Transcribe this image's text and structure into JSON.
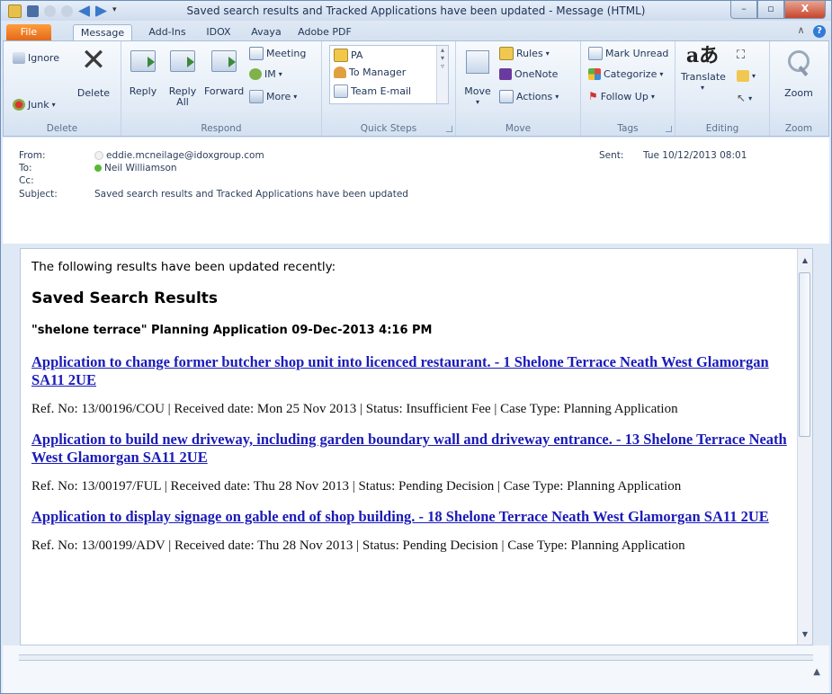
{
  "window": {
    "title": "Saved search results and Tracked Applications have been updated  -  Message (HTML)",
    "minimize": "–",
    "maximize": "▫",
    "close": "X"
  },
  "tabs": [
    "File",
    "Message",
    "Add-Ins",
    "IDOX",
    "Avaya",
    "Adobe PDF"
  ],
  "ribbon": {
    "delete_group": {
      "label": "Delete",
      "ignore": "Ignore",
      "junk": "Junk",
      "delete": "Delete"
    },
    "respond_group": {
      "label": "Respond",
      "reply": "Reply",
      "reply_all_1": "Reply",
      "reply_all_2": "All",
      "forward": "Forward",
      "meeting": "Meeting",
      "im": "IM",
      "more": "More"
    },
    "quick_steps": {
      "label": "Quick Steps",
      "items": [
        "PA",
        "To Manager",
        "Team E-mail"
      ]
    },
    "move_group": {
      "label": "Move",
      "move": "Move",
      "rules": "Rules",
      "onenote": "OneNote",
      "actions": "Actions"
    },
    "tags_group": {
      "label": "Tags",
      "mark_unread": "Mark Unread",
      "categorize": "Categorize",
      "follow_up": "Follow Up"
    },
    "editing_group": {
      "label": "Editing",
      "translate": "Translate"
    },
    "zoom_group": {
      "label": "Zoom",
      "zoom": "Zoom"
    }
  },
  "headers": {
    "from_label": "From:",
    "from": "eddie.mcneilage@idoxgroup.com",
    "to_label": "To:",
    "to": "Neil Williamson",
    "cc_label": "Cc:",
    "subject_label": "Subject:",
    "subject": "Saved search results and Tracked Applications have been updated",
    "sent_label": "Sent:",
    "sent": "Tue 10/12/2013 08:01"
  },
  "body": {
    "intro": "The following results have been updated recently:",
    "heading": "Saved Search Results",
    "search_title": "\"shelone terrace\" Planning Application 09-Dec-2013 4:16 PM",
    "results": [
      {
        "link": "Application to change former butcher shop unit into licenced restaurant. - 1 Shelone Terrace Neath West Glamorgan SA11 2UE",
        "ref": "Ref. No: 13/00196/COU | Received date: Mon 25 Nov 2013 | Status: Insufficient Fee | Case Type: Planning Application"
      },
      {
        "link": "Application to build new driveway, including garden boundary wall and driveway entrance. - 13 Shelone Terrace Neath West Glamorgan SA11 2UE",
        "ref": "Ref. No: 13/00197/FUL | Received date: Thu 28 Nov 2013 | Status: Pending Decision | Case Type: Planning Application"
      },
      {
        "link": "Application to display signage on gable end of shop building. - 18 Shelone Terrace Neath West Glamorgan SA11 2UE",
        "ref": "Ref. No: 13/00199/ADV | Received date: Thu 28 Nov 2013 | Status: Pending Decision | Case Type: Planning Application"
      }
    ]
  },
  "colors": {
    "link": "#1a1bb7",
    "file_tab": "#e2691b",
    "close_button": "#c8452b"
  }
}
